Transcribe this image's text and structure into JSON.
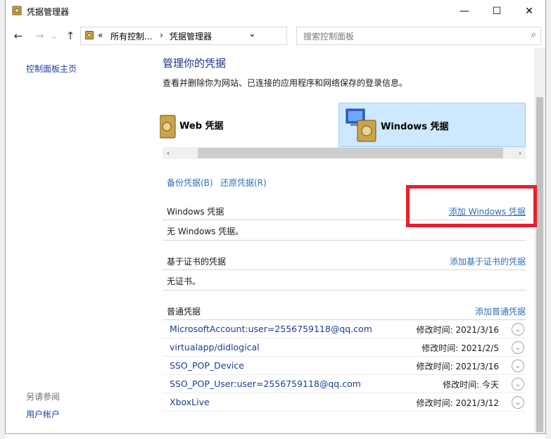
{
  "window": {
    "title": "凭据管理器",
    "minimize_glyph": "—",
    "maximize_glyph": "☐",
    "close_glyph": "✕"
  },
  "nav": {
    "back_glyph": "←",
    "forward_glyph": "→",
    "dropdown_glyph": "⌄",
    "up_glyph": "↑",
    "address_overflow": "«",
    "address_crumb_1": "所有控制...",
    "address_sep": "›",
    "address_crumb_2": "凭据管理器",
    "address_dropdown_glyph": "⌄",
    "refresh_glyph": "↻",
    "search_placeholder": "搜索控制面板",
    "search_glyph": "⌕"
  },
  "sidebar": {
    "home_link": "控制面板主页",
    "see_also_label": "另请参阅",
    "user_accounts_link": "用户帐户"
  },
  "main": {
    "heading": "管理你的凭据",
    "description": "查看并删除你为网站、已连接的应用程序和网络保存的登录信息。",
    "tabs": [
      {
        "label": "Web 凭据",
        "selected": false
      },
      {
        "label": "Windows 凭据",
        "selected": true
      }
    ],
    "hscroll_left": "‹",
    "hscroll_right": "›",
    "backup_link": "备份凭据(B)",
    "restore_link": "还原凭据(R)",
    "windows_section": {
      "title": "Windows 凭据",
      "add_link": "添加 Windows 凭据",
      "empty_text": "无 Windows 凭据。"
    },
    "cert_section": {
      "title": "基于证书的凭据",
      "add_link": "添加基于证书的凭据",
      "empty_text": "无证书。"
    },
    "generic_section": {
      "title": "普通凭据",
      "add_link": "添加普通凭据",
      "modified_label": "修改时间:",
      "expand_glyph": "⌄",
      "items": [
        {
          "name": "MicrosoftAccount:user=2556759118@qq.com",
          "modified": "2021/3/16"
        },
        {
          "name": "virtualapp/didlogical",
          "modified": "2021/2/5"
        },
        {
          "name": "SSO_POP_Device",
          "modified": "2021/3/16"
        },
        {
          "name": "SSO_POP_User:user=2556759118@qq.com",
          "modified": "今天"
        },
        {
          "name": "XboxLive",
          "modified": "2021/3/12"
        }
      ]
    }
  },
  "colors": {
    "link": "#2c6fbf",
    "heading": "#1e3287",
    "selected_tab": "#cde8ff",
    "highlight_box": "#e8202a"
  }
}
